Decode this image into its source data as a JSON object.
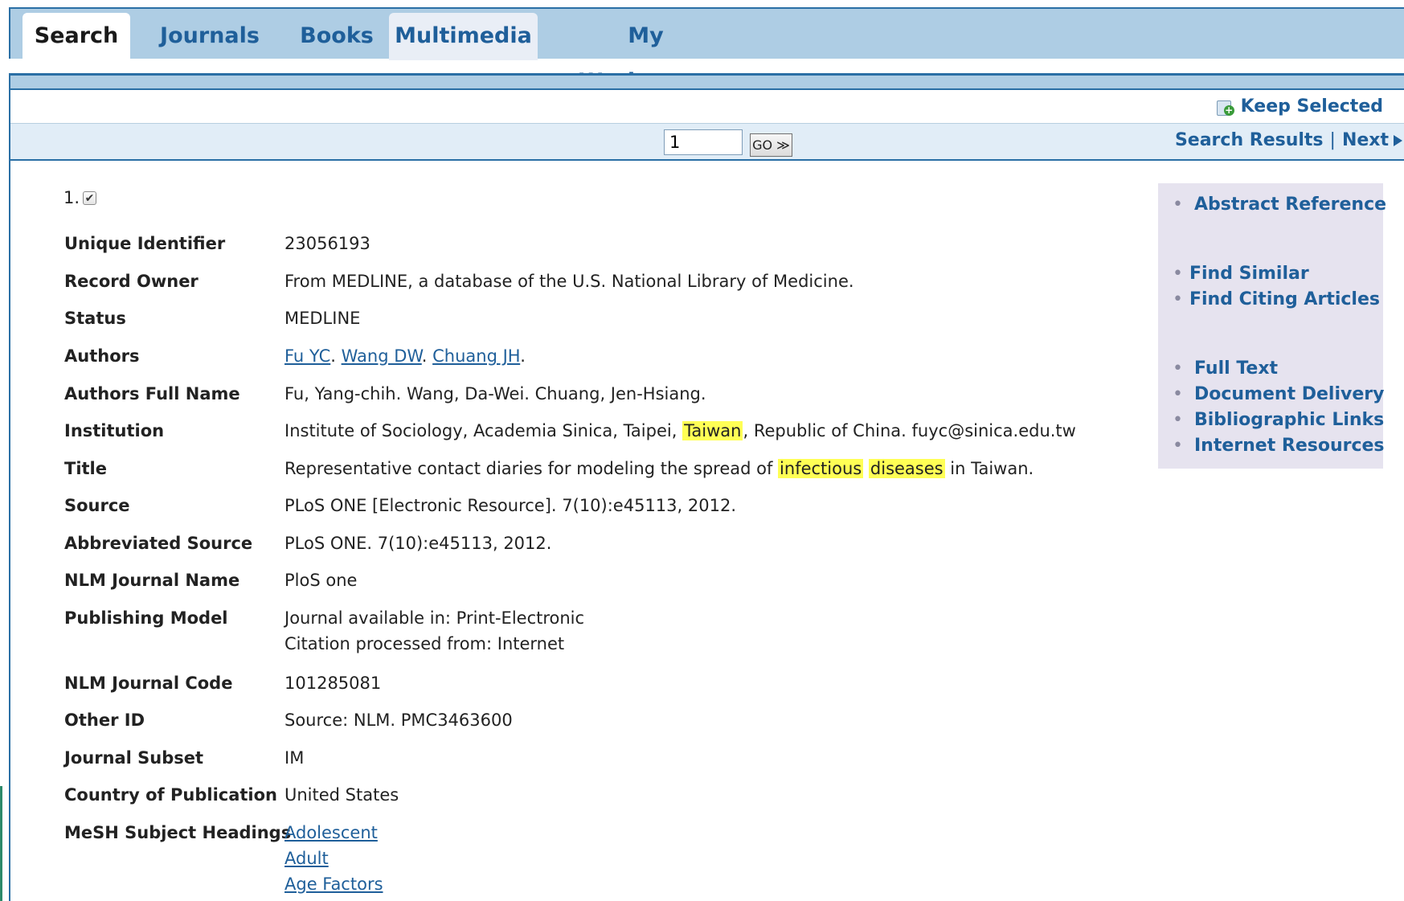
{
  "tabs": [
    "Search",
    "Journals",
    "Books",
    "Multimedia",
    "My Workspace"
  ],
  "toolbar": {
    "keep_selected": "Keep Selected"
  },
  "nav": {
    "page_value": "1",
    "go_label": "GO ≫",
    "search_results": "Search Results",
    "separator": "|",
    "next": "Next"
  },
  "record": {
    "number": "1.",
    "fields": {
      "unique_identifier": {
        "label": "Unique Identifier",
        "value": "23056193"
      },
      "record_owner": {
        "label": "Record Owner",
        "value": "From MEDLINE, a database of the U.S. National Library of Medicine."
      },
      "status": {
        "label": "Status",
        "value": "MEDLINE"
      },
      "authors": {
        "label": "Authors",
        "values": [
          "Fu YC",
          "Wang DW",
          "Chuang JH"
        ]
      },
      "authors_full_name": {
        "label": "Authors Full Name",
        "value": "Fu, Yang-chih. Wang, Da-Wei. Chuang, Jen-Hsiang."
      },
      "institution": {
        "label": "Institution",
        "pre": "Institute of Sociology, Academia Sinica, Taipei, ",
        "highlight": "Taiwan",
        "post": ", Republic of China. fuyc@sinica.edu.tw"
      },
      "title": {
        "label": "Title",
        "pre": "Representative contact diaries for modeling the spread of ",
        "highlight1": "infectious",
        "highlight2": "diseases",
        "post": " in Taiwan."
      },
      "source": {
        "label": "Source",
        "value": "PLoS ONE [Electronic Resource]. 7(10):e45113, 2012."
      },
      "abbreviated_source": {
        "label": "Abbreviated Source",
        "value": "PLoS ONE. 7(10):e45113, 2012."
      },
      "nlm_journal_name": {
        "label": "NLM Journal Name",
        "value": "PloS one"
      },
      "publishing_model": {
        "label": "Publishing Model",
        "line1": "Journal available in: Print-Electronic",
        "line2": "Citation processed from: Internet"
      },
      "nlm_journal_code": {
        "label": "NLM Journal Code",
        "value": "101285081"
      },
      "other_id": {
        "label": "Other ID",
        "value": "Source: NLM. PMC3463600"
      },
      "journal_subset": {
        "label": "Journal Subset",
        "value": "IM"
      },
      "country": {
        "label": "Country of Publication",
        "value": "United States"
      },
      "mesh": {
        "label": "MeSH Subject Headings",
        "values": [
          "Adolescent",
          "Adult",
          "Age Factors"
        ]
      }
    }
  },
  "sidebar": {
    "abstract_reference": "Abstract Reference",
    "find_similar": "Find Similar",
    "find_citing": "Find Citing Articles",
    "full_text": "Full Text",
    "document_delivery": "Document Delivery",
    "bibliographic_links": "Bibliographic Links",
    "internet_resources": "Internet Resources"
  },
  "colors": {
    "tab_bar": "#aecde4",
    "link": "#1f5f9a",
    "highlight": "#ffff55",
    "sidebar_bg": "#e6e3ef"
  }
}
